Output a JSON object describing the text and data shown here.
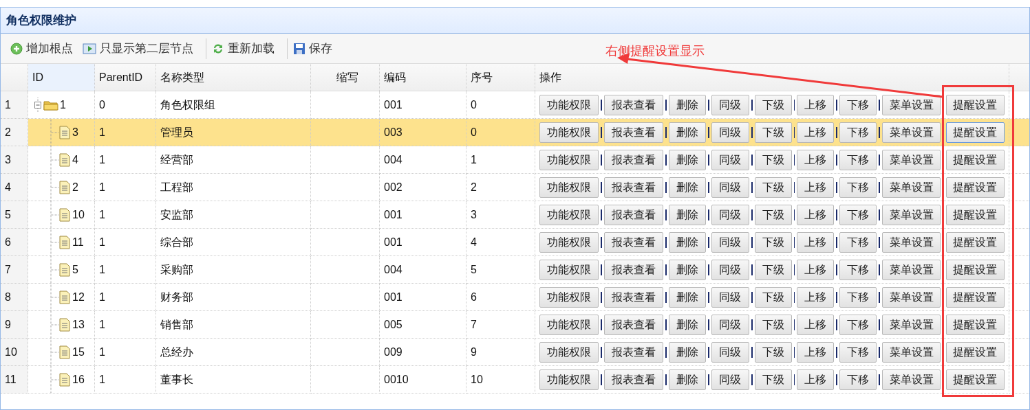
{
  "panel": {
    "title": "角色权限维护"
  },
  "toolbar": [
    {
      "kind": "add",
      "label": "增加根点"
    },
    {
      "kind": "level",
      "label": "只显示第二层节点"
    },
    {
      "kind": "reload",
      "label": "重新加载"
    },
    {
      "kind": "save",
      "label": "保存"
    }
  ],
  "table": {
    "columns": [
      "ID",
      "ParentID",
      "名称类型",
      "缩写",
      "编码",
      "序号",
      "操作"
    ],
    "rows": [
      {
        "row_number": "1",
        "id": "1",
        "parent_id": "0",
        "name": "角色权限组",
        "code": "001",
        "order": "0",
        "selected": false,
        "expanded": true,
        "actions": [
          {
            "label": "功能权限",
            "focused": false
          },
          {
            "label": "报表查看",
            "focused": false
          },
          {
            "label": "删除",
            "focused": false
          },
          {
            "label": "同级",
            "focused": false
          },
          {
            "label": "下级",
            "focused": false
          },
          {
            "label": "上移",
            "focused": false
          },
          {
            "label": "下移",
            "focused": false
          },
          {
            "label": "菜单设置",
            "focused": false
          },
          {
            "label": "提醒设置",
            "focused": false
          }
        ],
        "children": [
          {
            "row_number": "2",
            "id": "3",
            "parent_id": "1",
            "name": "管理员",
            "code": "003",
            "order": "0",
            "selected": true,
            "actions": [
              {
                "label": "功能权限",
                "focused": false
              },
              {
                "label": "报表查看",
                "focused": false
              },
              {
                "label": "删除",
                "focused": false
              },
              {
                "label": "同级",
                "focused": false
              },
              {
                "label": "下级",
                "focused": false
              },
              {
                "label": "上移",
                "focused": false
              },
              {
                "label": "下移",
                "focused": false
              },
              {
                "label": "菜单设置",
                "focused": false
              },
              {
                "label": "提醒设置",
                "focused": true
              }
            ]
          },
          {
            "row_number": "3",
            "id": "4",
            "parent_id": "1",
            "name": "经营部",
            "code": "004",
            "order": "1",
            "selected": false,
            "actions": [
              {
                "label": "功能权限",
                "focused": false
              },
              {
                "label": "报表查看",
                "focused": false
              },
              {
                "label": "删除",
                "focused": false
              },
              {
                "label": "同级",
                "focused": false
              },
              {
                "label": "下级",
                "focused": false
              },
              {
                "label": "上移",
                "focused": false
              },
              {
                "label": "下移",
                "focused": false
              },
              {
                "label": "菜单设置",
                "focused": false
              },
              {
                "label": "提醒设置",
                "focused": false
              }
            ]
          },
          {
            "row_number": "4",
            "id": "2",
            "parent_id": "1",
            "name": "工程部",
            "code": "002",
            "order": "2",
            "selected": false,
            "actions": [
              {
                "label": "功能权限",
                "focused": false
              },
              {
                "label": "报表查看",
                "focused": false
              },
              {
                "label": "删除",
                "focused": false
              },
              {
                "label": "同级",
                "focused": false
              },
              {
                "label": "下级",
                "focused": false
              },
              {
                "label": "上移",
                "focused": false
              },
              {
                "label": "下移",
                "focused": false
              },
              {
                "label": "菜单设置",
                "focused": false
              },
              {
                "label": "提醒设置",
                "focused": false
              }
            ]
          },
          {
            "row_number": "5",
            "id": "10",
            "parent_id": "1",
            "name": "安监部",
            "code": "001",
            "order": "3",
            "selected": false,
            "actions": [
              {
                "label": "功能权限",
                "focused": false
              },
              {
                "label": "报表查看",
                "focused": false
              },
              {
                "label": "删除",
                "focused": false
              },
              {
                "label": "同级",
                "focused": false
              },
              {
                "label": "下级",
                "focused": false
              },
              {
                "label": "上移",
                "focused": false
              },
              {
                "label": "下移",
                "focused": false
              },
              {
                "label": "菜单设置",
                "focused": false
              },
              {
                "label": "提醒设置",
                "focused": false
              }
            ]
          },
          {
            "row_number": "6",
            "id": "11",
            "parent_id": "1",
            "name": "综合部",
            "code": "001",
            "order": "4",
            "selected": false,
            "actions": [
              {
                "label": "功能权限",
                "focused": false
              },
              {
                "label": "报表查看",
                "focused": false
              },
              {
                "label": "删除",
                "focused": false
              },
              {
                "label": "同级",
                "focused": false
              },
              {
                "label": "下级",
                "focused": false
              },
              {
                "label": "上移",
                "focused": false
              },
              {
                "label": "下移",
                "focused": false
              },
              {
                "label": "菜单设置",
                "focused": false
              },
              {
                "label": "提醒设置",
                "focused": false
              }
            ]
          },
          {
            "row_number": "7",
            "id": "5",
            "parent_id": "1",
            "name": "采购部",
            "code": "004",
            "order": "5",
            "selected": false,
            "actions": [
              {
                "label": "功能权限",
                "focused": false
              },
              {
                "label": "报表查看",
                "focused": false
              },
              {
                "label": "删除",
                "focused": false
              },
              {
                "label": "同级",
                "focused": false
              },
              {
                "label": "下级",
                "focused": false
              },
              {
                "label": "上移",
                "focused": false
              },
              {
                "label": "下移",
                "focused": false
              },
              {
                "label": "菜单设置",
                "focused": false
              },
              {
                "label": "提醒设置",
                "focused": false
              }
            ]
          },
          {
            "row_number": "8",
            "id": "12",
            "parent_id": "1",
            "name": "财务部",
            "code": "001",
            "order": "6",
            "selected": false,
            "actions": [
              {
                "label": "功能权限",
                "focused": false
              },
              {
                "label": "报表查看",
                "focused": false
              },
              {
                "label": "删除",
                "focused": false
              },
              {
                "label": "同级",
                "focused": false
              },
              {
                "label": "下级",
                "focused": false
              },
              {
                "label": "上移",
                "focused": false
              },
              {
                "label": "下移",
                "focused": false
              },
              {
                "label": "菜单设置",
                "focused": false
              },
              {
                "label": "提醒设置",
                "focused": false
              }
            ]
          },
          {
            "row_number": "9",
            "id": "13",
            "parent_id": "1",
            "name": "销售部",
            "code": "005",
            "order": "7",
            "selected": false,
            "actions": [
              {
                "label": "功能权限",
                "focused": false
              },
              {
                "label": "报表查看",
                "focused": false
              },
              {
                "label": "删除",
                "focused": false
              },
              {
                "label": "同级",
                "focused": false
              },
              {
                "label": "下级",
                "focused": false
              },
              {
                "label": "上移",
                "focused": false
              },
              {
                "label": "下移",
                "focused": false
              },
              {
                "label": "菜单设置",
                "focused": false
              },
              {
                "label": "提醒设置",
                "focused": false
              }
            ]
          },
          {
            "row_number": "10",
            "id": "15",
            "parent_id": "1",
            "name": "总经办",
            "code": "009",
            "order": "9",
            "selected": false,
            "actions": [
              {
                "label": "功能权限",
                "focused": false
              },
              {
                "label": "报表查看",
                "focused": false
              },
              {
                "label": "删除",
                "focused": false
              },
              {
                "label": "同级",
                "focused": false
              },
              {
                "label": "下级",
                "focused": false
              },
              {
                "label": "上移",
                "focused": false
              },
              {
                "label": "下移",
                "focused": false
              },
              {
                "label": "菜单设置",
                "focused": false
              },
              {
                "label": "提醒设置",
                "focused": false
              }
            ]
          },
          {
            "row_number": "11",
            "id": "16",
            "parent_id": "1",
            "name": "董事长",
            "code": "0010",
            "order": "10",
            "selected": false,
            "actions": [
              {
                "label": "功能权限",
                "focused": false
              },
              {
                "label": "报表查看",
                "focused": false
              },
              {
                "label": "删除",
                "focused": false
              },
              {
                "label": "同级",
                "focused": false
              },
              {
                "label": "下级",
                "focused": false
              },
              {
                "label": "上移",
                "focused": false
              },
              {
                "label": "下移",
                "focused": false
              },
              {
                "label": "菜单设置",
                "focused": false
              },
              {
                "label": "提醒设置",
                "focused": false
              }
            ]
          }
        ]
      }
    ]
  },
  "annotation": {
    "text": "右侧提醒设置显示"
  }
}
